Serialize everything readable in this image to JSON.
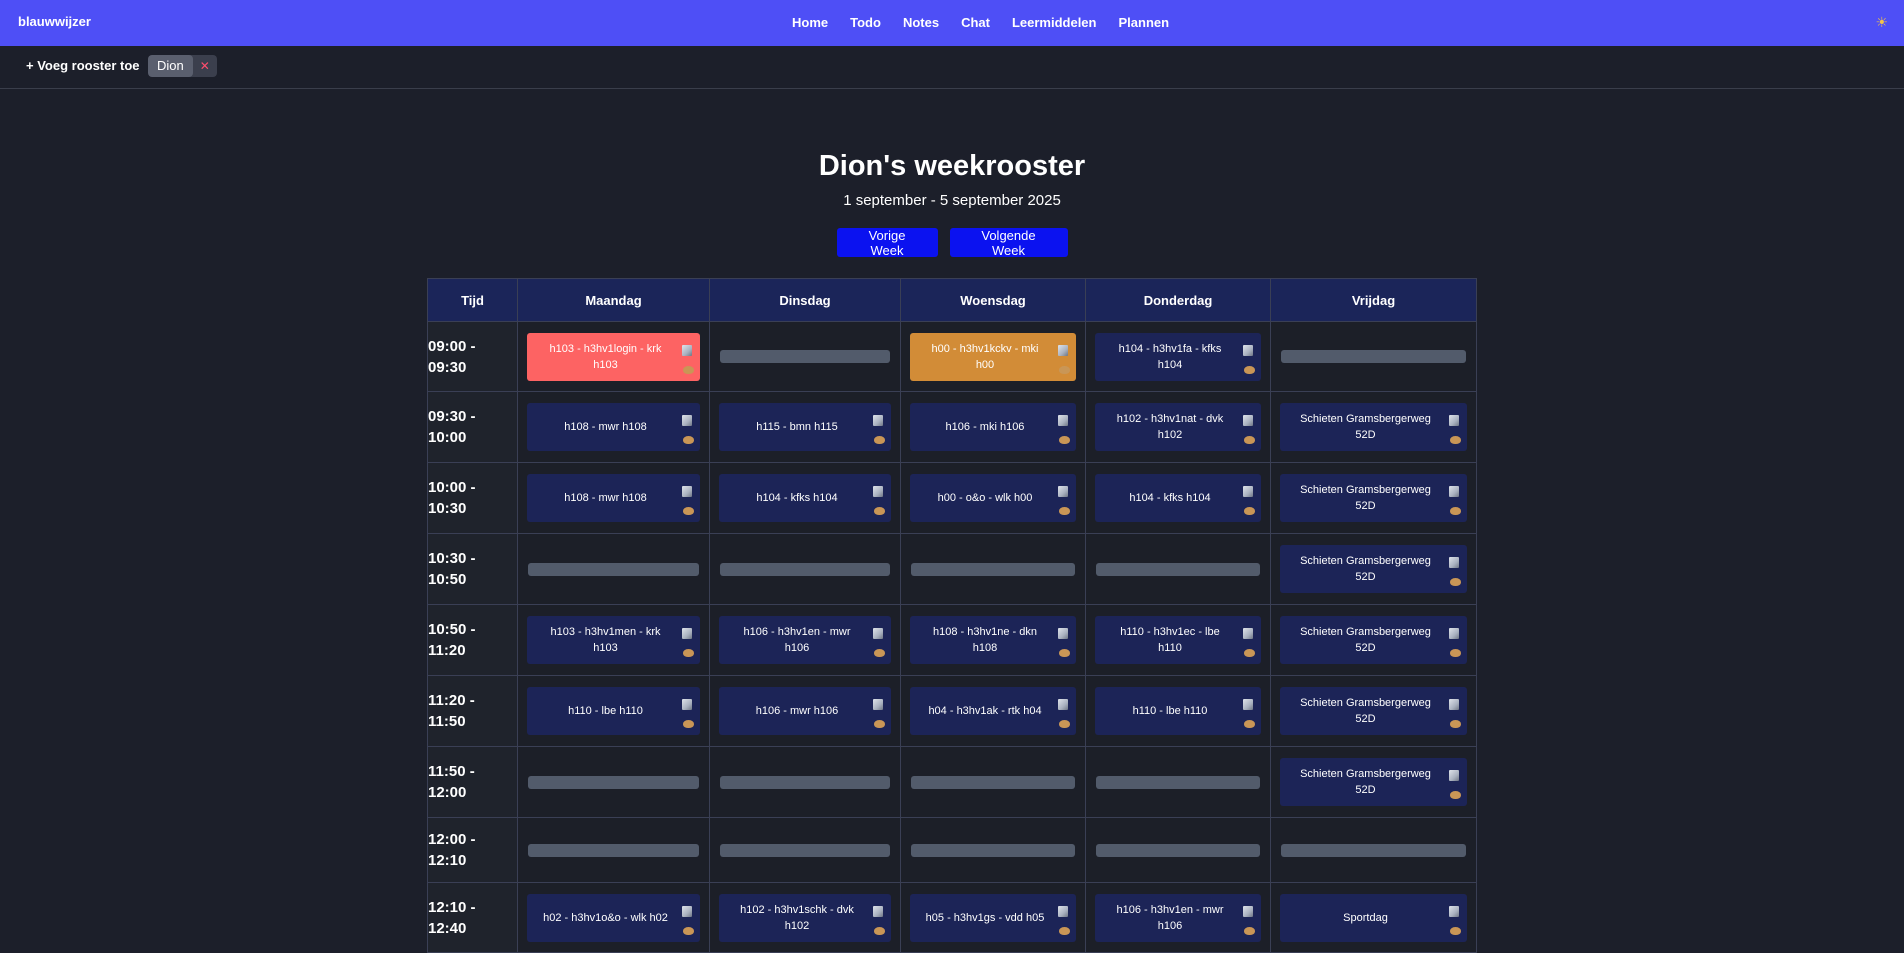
{
  "navbar": {
    "brand": "blauwwijzer",
    "links": [
      "Home",
      "Todo",
      "Notes",
      "Chat",
      "Leermiddelen",
      "Plannen"
    ],
    "theme_icon": "sun-icon",
    "theme_glyph": "☀"
  },
  "toolbar": {
    "add_label": "+ Voeg rooster toe",
    "chip_label": "Dion",
    "chip_close": "✕"
  },
  "header": {
    "title": "Dion's weekrooster",
    "date_range": "1 september - 5 september 2025",
    "prev_label": "Vorige Week",
    "next_label": "Volgende Week"
  },
  "colors": {
    "accent": "#4e4ff6",
    "button": "#0b12f0",
    "lesson": "#1c2457",
    "lesson_red": "#fd6363",
    "lesson_orange": "#d28c37"
  },
  "schedule": {
    "headers": [
      "Tijd",
      "Maandag",
      "Dinsdag",
      "Woensdag",
      "Donderdag",
      "Vrijdag"
    ],
    "rows": [
      {
        "time": [
          "09:00 -",
          "09:30"
        ],
        "cells": [
          {
            "text": "h103 - h3hv1login - krk h103",
            "color": "red"
          },
          null,
          {
            "text": "h00 - h3hv1kckv - mki h00",
            "color": "orange"
          },
          {
            "text": "h104 - h3hv1fa - kfks h104"
          },
          null
        ]
      },
      {
        "time": [
          "09:30 -",
          "10:00"
        ],
        "cells": [
          {
            "text": "h108 - mwr h108"
          },
          {
            "text": "h115 - bmn h115"
          },
          {
            "text": "h106 - mki h106"
          },
          {
            "text": "h102 - h3hv1nat - dvk h102"
          },
          {
            "text": "Schieten Gramsbergerweg 52D"
          }
        ]
      },
      {
        "time": [
          "10:00 -",
          "10:30"
        ],
        "cells": [
          {
            "text": "h108 - mwr h108"
          },
          {
            "text": "h104 - kfks h104"
          },
          {
            "text": "h00 - o&o - wlk h00"
          },
          {
            "text": "h104 - kfks h104"
          },
          {
            "text": "Schieten Gramsbergerweg 52D"
          }
        ]
      },
      {
        "time": [
          "10:30 -",
          "10:50"
        ],
        "cells": [
          null,
          null,
          null,
          null,
          {
            "text": "Schieten Gramsbergerweg 52D"
          }
        ]
      },
      {
        "time": [
          "10:50 -",
          "11:20"
        ],
        "cells": [
          {
            "text": "h103 - h3hv1men - krk h103"
          },
          {
            "text": "h106 - h3hv1en - mwr h106"
          },
          {
            "text": "h108 - h3hv1ne - dkn h108"
          },
          {
            "text": "h110 - h3hv1ec - lbe h110"
          },
          {
            "text": "Schieten Gramsbergerweg 52D"
          }
        ]
      },
      {
        "time": [
          "11:20 -",
          "11:50"
        ],
        "cells": [
          {
            "text": "h110 - lbe h110"
          },
          {
            "text": "h106 - mwr h106"
          },
          {
            "text": "h04 - h3hv1ak - rtk h04"
          },
          {
            "text": "h110 - lbe h110"
          },
          {
            "text": "Schieten Gramsbergerweg 52D"
          }
        ]
      },
      {
        "time": [
          "11:50 -",
          "12:00"
        ],
        "cells": [
          null,
          null,
          null,
          null,
          {
            "text": "Schieten Gramsbergerweg 52D"
          }
        ]
      },
      {
        "time": [
          "12:00 -",
          "12:10"
        ],
        "cells": [
          null,
          null,
          null,
          null,
          null
        ]
      },
      {
        "time": [
          "12:10 -",
          "12:40"
        ],
        "cells": [
          {
            "text": "h02 - h3hv1o&o - wlk h02"
          },
          {
            "text": "h102 - h3hv1schk - dvk h102"
          },
          {
            "text": "h05 - h3hv1gs - vdd h05"
          },
          {
            "text": "h106 - h3hv1en - mwr h106"
          },
          {
            "text": "Sportdag"
          }
        ]
      }
    ]
  }
}
